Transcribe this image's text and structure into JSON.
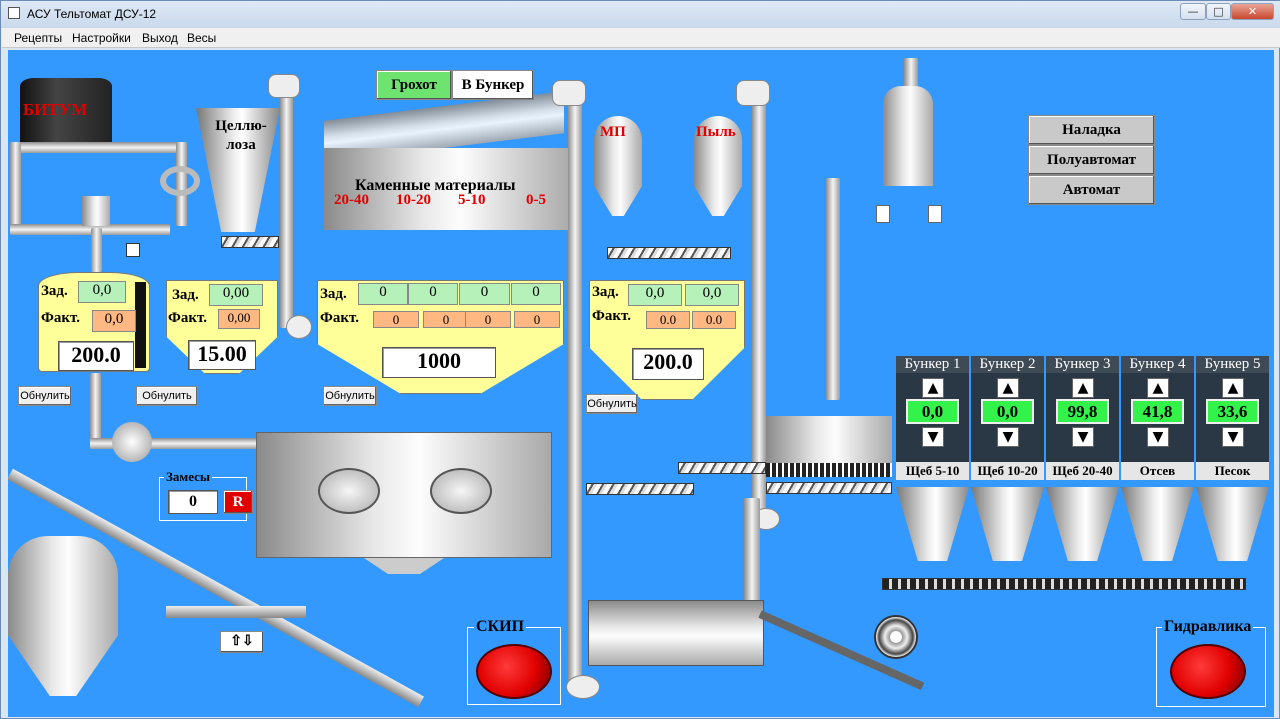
{
  "window": {
    "title": "АСУ Тельтомат ДСУ-12",
    "min": "—",
    "max": "□",
    "close": "✕"
  },
  "menu": [
    "Рецепты",
    "Настройки",
    "Выход",
    "Весы"
  ],
  "bitum": {
    "label": "БИТУМ",
    "zad_label": "Зад.",
    "fakt_label": "Факт.",
    "zad": "0,0",
    "fakt": "0,0",
    "weight": "200.0",
    "reset": "Обнулить"
  },
  "cellulose": {
    "label": "Целлю-\nлоза",
    "zad_label": "Зад.",
    "fakt_label": "Факт.",
    "zad": "0,00",
    "fakt": "0,00",
    "weight": "15.00",
    "reset": "Обнулить"
  },
  "stone": {
    "label": "Каменные материалы",
    "fractions": [
      "20-40",
      "10-20",
      "5-10",
      "0-5"
    ],
    "zad_label": "Зад.",
    "fakt_label": "Факт.",
    "zad": [
      "0",
      "0",
      "0",
      "0"
    ],
    "fakt": [
      "0",
      "0",
      "0",
      "0"
    ],
    "weight": "1000",
    "reset": "Обнулить"
  },
  "screen_toggle": {
    "grokhot": "Грохот",
    "bunker": "В Бункер"
  },
  "mp": {
    "label_mp": "МП",
    "label_dust": "Пыль",
    "zad_label": "Зад.",
    "fakt_label": "Факт.",
    "zad": [
      "0,0",
      "0,0"
    ],
    "fakt": [
      "0.0",
      "0.0"
    ],
    "weight": "200.0",
    "reset": "Обнулить"
  },
  "modes": [
    "Наладка",
    "Полуавтомат",
    "Автомат"
  ],
  "batches": {
    "label": "Замесы",
    "value": "0",
    "reset": "R"
  },
  "bunkers": [
    {
      "title": "Бункер 1",
      "value": "0,0",
      "name": "Щеб 5-10"
    },
    {
      "title": "Бункер 2",
      "value": "0,0",
      "name": "Щеб 10-20"
    },
    {
      "title": "Бункер 3",
      "value": "99,8",
      "name": "Щеб 20-40"
    },
    {
      "title": "Бункер 4",
      "value": "41,8",
      "name": "Отсев"
    },
    {
      "title": "Бункер 5",
      "value": "33,6",
      "name": "Песок"
    }
  ],
  "skip": {
    "label": "СКИП"
  },
  "hydraulics": {
    "label": "Гидравлика"
  },
  "updown": "⇧⇩",
  "colors": {
    "background": "#3399ff",
    "green_cell": "#b6f1b9",
    "orange_cell": "#ffb882",
    "scale_yellow": "#ffff9a",
    "bunker_value": "#33f24a",
    "stop_red": "#e00000"
  },
  "icons": [
    "window-icon",
    "arrow-up-icon",
    "arrow-down-icon",
    "fan-icon"
  ]
}
